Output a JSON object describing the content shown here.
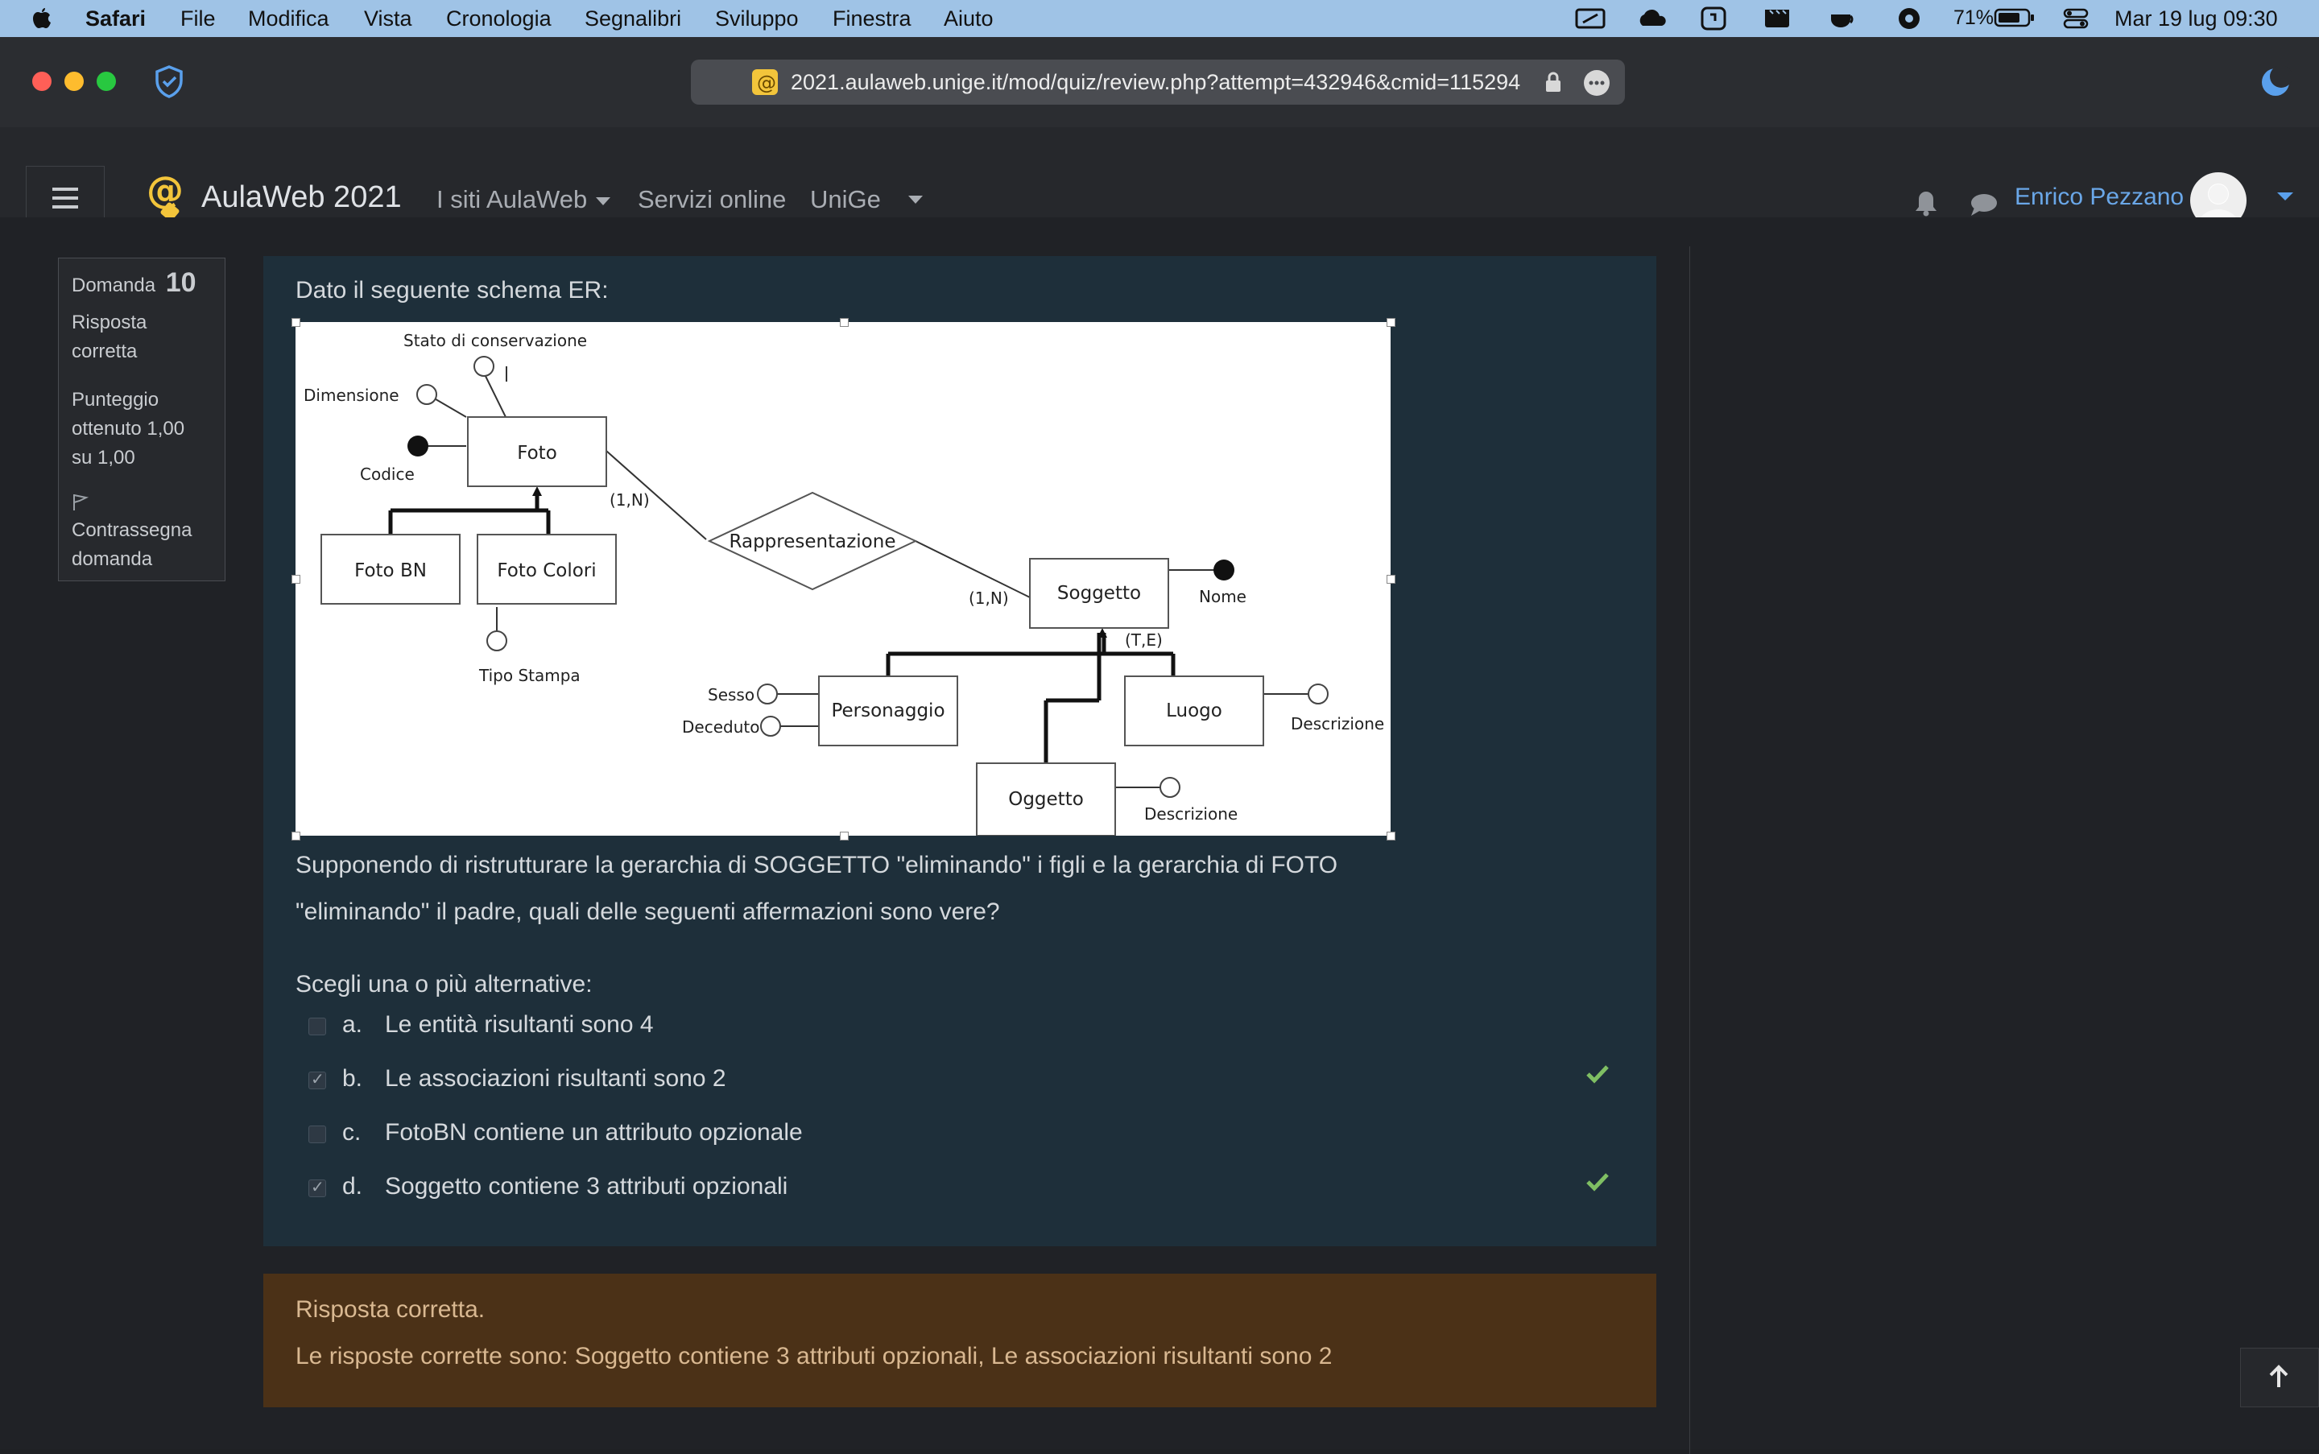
{
  "menubar": {
    "app": "Safari",
    "items": [
      "File",
      "Modifica",
      "Vista",
      "Cronologia",
      "Segnalibri",
      "Sviluppo",
      "Finestra",
      "Aiuto"
    ],
    "battery": "71%",
    "datetime": "Mar 19 lug  09:30"
  },
  "browser": {
    "url": "2021.aulaweb.unige.it/mod/quiz/review.php?attempt=432946&cmid=115294"
  },
  "site": {
    "title": "AulaWeb 2021",
    "nav": [
      "I siti AulaWeb",
      "Servizi online",
      "UniGe"
    ],
    "user": "Enrico Pezzano"
  },
  "question_info": {
    "label": "Domanda",
    "number": "10",
    "status": "Risposta corretta",
    "score": "Punteggio ottenuto 1,00 su 1,00",
    "flag": "Contrassegna domanda"
  },
  "question": {
    "intro": "Dato il seguente schema ER:",
    "text_line1": "Supponendo di ristrutturare la gerarchia di SOGGETTO \"eliminando\" i figli e la gerarchia di FOTO",
    "text_line2": "\"eliminando\" il padre, quali delle seguenti affermazioni sono vere?",
    "prompt": "Scegli una o più alternative:",
    "options": [
      {
        "letter": "a.",
        "text": "Le entità risultanti sono 4",
        "checked": false,
        "correct": false
      },
      {
        "letter": "b.",
        "text": "Le associazioni risultanti sono 2",
        "checked": true,
        "correct": true
      },
      {
        "letter": "c.",
        "text": "FotoBN contiene un attributo opzionale",
        "checked": false,
        "correct": false
      },
      {
        "letter": "d.",
        "text": "Soggetto contiene 3 attributi opzionali",
        "checked": true,
        "correct": true
      }
    ]
  },
  "diagram": {
    "foto": "Foto",
    "foto_bn": "Foto BN",
    "foto_colori": "Foto Colori",
    "rappresentazione": "Rappresentazione",
    "soggetto": "Soggetto",
    "personaggio": "Personaggio",
    "luogo": "Luogo",
    "oggetto": "Oggetto",
    "stato": "Stato di conservazione",
    "dimensione": "Dimensione",
    "codice": "Codice",
    "tipo_stampa": "Tipo Stampa",
    "nome": "Nome",
    "sesso": "Sesso",
    "deceduto": "Deceduto",
    "descrizione": "Descrizione",
    "card1": "(1,N)",
    "card2": "(1,N)",
    "te": "(T,E)"
  },
  "feedback": {
    "line1": "Risposta corretta.",
    "line2": "Le risposte corrette sono: Soggetto contiene 3 attributi opzionali, Le associazioni risultanti sono 2"
  }
}
